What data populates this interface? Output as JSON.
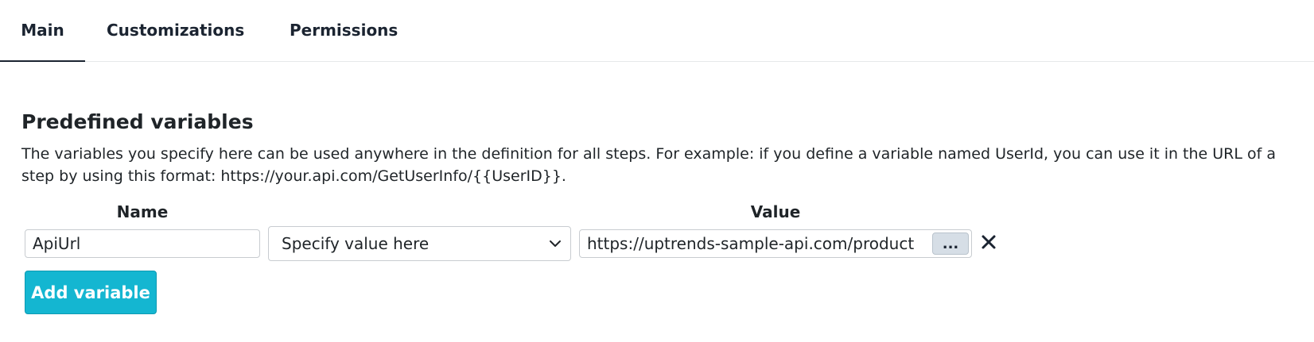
{
  "tabs": [
    {
      "label": "Main",
      "active": true
    },
    {
      "label": "Customizations",
      "active": false
    },
    {
      "label": "Permissions",
      "active": false
    }
  ],
  "section": {
    "title": "Predefined variables",
    "description": "The variables you specify here can be used anywhere in the definition for all steps. For example: if you define a variable named UserId, you can use it in the URL of a step by using this format: https://your.api.com/GetUserInfo/{{UserID}}."
  },
  "table": {
    "headers": {
      "name": "Name",
      "value": "Value"
    },
    "rows": [
      {
        "name": "ApiUrl",
        "value_type": "Specify value here",
        "value": "https://uptrends-sample-api.com/product",
        "more_label": "..."
      }
    ]
  },
  "actions": {
    "add_variable": "Add variable"
  },
  "colors": {
    "accent": "#14b6d1",
    "text": "#1f2428"
  },
  "icons": {
    "dropdown": "chevron-down-icon",
    "remove": "close-icon"
  }
}
